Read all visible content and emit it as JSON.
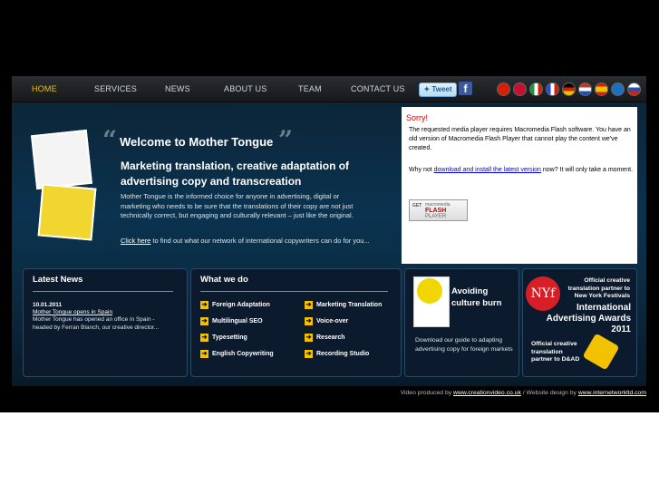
{
  "nav": {
    "items": [
      "HOME",
      "SERVICES",
      "NEWS",
      "ABOUT US",
      "TEAM",
      "CONTACT US"
    ],
    "tweet_label": "Tweet",
    "facebook_label": "f",
    "flags": [
      "#d81e05",
      "#ffffff",
      "#e0e0e0",
      "#2a4bd6",
      "#f2c200",
      "#c0392b",
      "#d81e05",
      "#1f6fbf",
      "#c0392b"
    ]
  },
  "hero": {
    "welcome": "Welcome to Mother Tongue",
    "open_quote": "“",
    "close_quote": "”",
    "subheading": "Marketing translation, creative adaptation of advertising copy and transcreation",
    "body": "Mother Tongue is the informed choice for anyone in advertising, digital or marketing who needs to be sure that the translations of their copy are not just technically correct, but engaging and culturally relevant – just like the original.",
    "click_link": "Click here",
    "click_text": " to find out what our network of international copywriters can do for you..."
  },
  "flash": {
    "sorry": "Sorry!",
    "text1": "The requested media player requires Macromedia Flash software. You have an old version of Macromedia Flash Player that cannot play the content we've created.",
    "text2_prefix": "Why not ",
    "text2_link": "download and install the latest version",
    "text2_suffix": " now? It will only take a moment.",
    "get_label": "GET",
    "macromedia": "macromedia",
    "flash_word": "FLASH",
    "player_word": "PLAYER"
  },
  "news": {
    "title": "Latest News",
    "date": "10.01.2011",
    "link": "Mother Tongue opens in Spain",
    "body": "Mother Tongue has opened an office in Spain - headed by Ferran Blanch, our creative director..."
  },
  "whatwedo": {
    "title": "What we do",
    "items": [
      "Foreign Adaptation",
      "Marketing Translation",
      "Multilingual SEO",
      "Voice-over",
      "Typesetting",
      "Research",
      "English Copywriting",
      "Recording Studio"
    ]
  },
  "avoid": {
    "title": "Avoiding culture burn",
    "body": "Download our guide to adapting advertising copy for foreign markets"
  },
  "awards": {
    "nyf_logo": "NYf",
    "line1": "Official creative translation partner to New York Festivals",
    "line2": "International Advertising Awards 2011",
    "line3": "Official creative translation partner to D&AD"
  },
  "footer": {
    "prefix": "Video produced by ",
    "video_link": "www.creationvideo.co.uk",
    "middle": " / Website design by ",
    "design_link": "www.internetworkltd.com"
  }
}
